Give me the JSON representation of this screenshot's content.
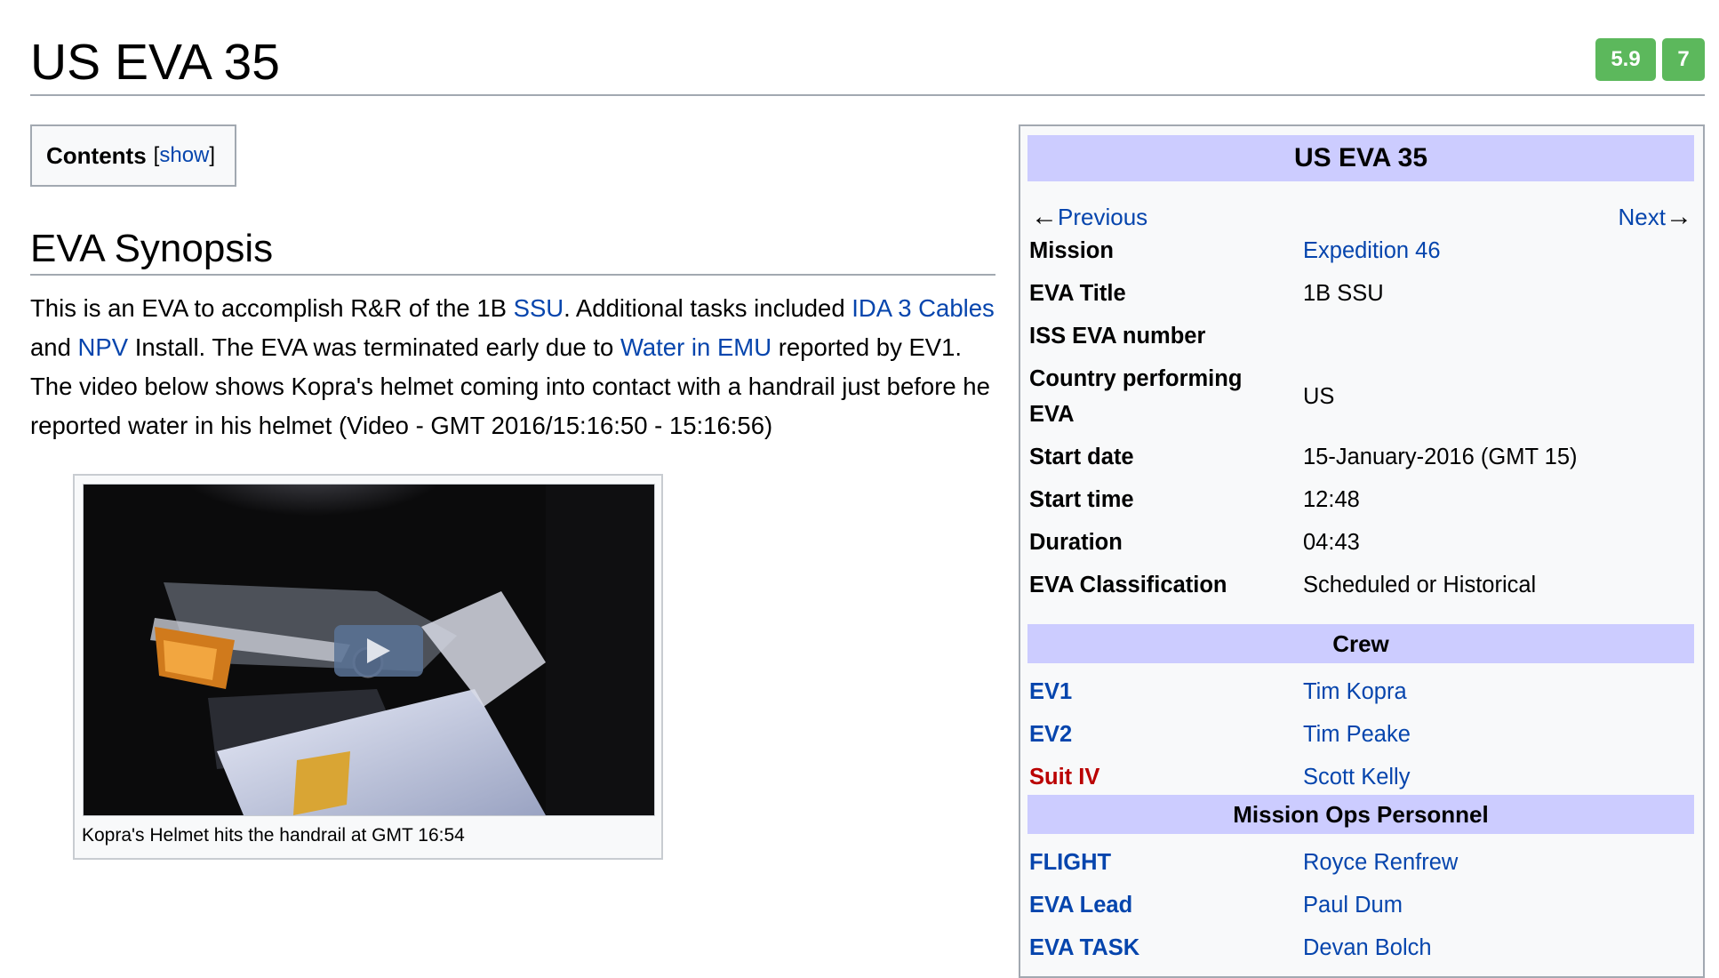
{
  "page": {
    "title": "US EVA 35",
    "badges": [
      "5.9",
      "7"
    ]
  },
  "toc": {
    "title": "Contents",
    "open_bracket": "[",
    "toggle": "show",
    "close_bracket": "]"
  },
  "synopsis": {
    "heading": "EVA Synopsis",
    "parts": [
      {
        "text": "This is an EVA to accomplish R&R of the 1B "
      },
      {
        "link": "SSU"
      },
      {
        "text": ". Additional tasks included "
      },
      {
        "link": "IDA 3 Cables"
      },
      {
        "text": " and "
      },
      {
        "link": "NPV"
      },
      {
        "text": " Install. The EVA was terminated early due to "
      },
      {
        "link": "Water in EMU"
      },
      {
        "text": " reported by EV1. The video below shows Kopra's helmet coming into contact with a handrail just before he reported water in his helmet (Video - GMT 2016/15:16:50 - 15:16:56)"
      }
    ]
  },
  "video": {
    "caption": "Kopra's Helmet hits the handrail at GMT 16:54",
    "play_icon": "play-icon"
  },
  "infobox": {
    "title": "US EVA 35",
    "previous": "Previous",
    "next": "Next",
    "rows": [
      {
        "label": "Mission",
        "value": "Expedition 46",
        "value_link": true
      },
      {
        "label": "EVA Title",
        "value": "1B SSU"
      },
      {
        "label": "ISS EVA number",
        "value": ""
      },
      {
        "label": "Country performing EVA",
        "value": "US"
      },
      {
        "label": "Start date",
        "value": "15-January-2016 (GMT 15)"
      },
      {
        "label": "Start time",
        "value": "12:48"
      },
      {
        "label": "Duration",
        "value": "04:43"
      },
      {
        "label": "EVA Classification",
        "value": "Scheduled or Historical"
      }
    ],
    "crew_header": "Crew",
    "crew": [
      {
        "label": "EV1",
        "value": "Tim Kopra"
      },
      {
        "label": "EV2",
        "value": "Tim Peake"
      },
      {
        "label": "Suit IV",
        "value": "Scott Kelly"
      }
    ],
    "ops_header": "Mission Ops Personnel",
    "ops": [
      {
        "label": "FLIGHT",
        "value": "Royce Renfrew"
      },
      {
        "label": "EVA Lead",
        "value": "Paul Dum"
      },
      {
        "label": "EVA TASK",
        "value": "Devan Bolch"
      }
    ]
  },
  "colors": {
    "link": "#0645ad",
    "redlink": "#ba0000",
    "infobox_header": "#ccccff",
    "badge": "#5cb85c"
  }
}
